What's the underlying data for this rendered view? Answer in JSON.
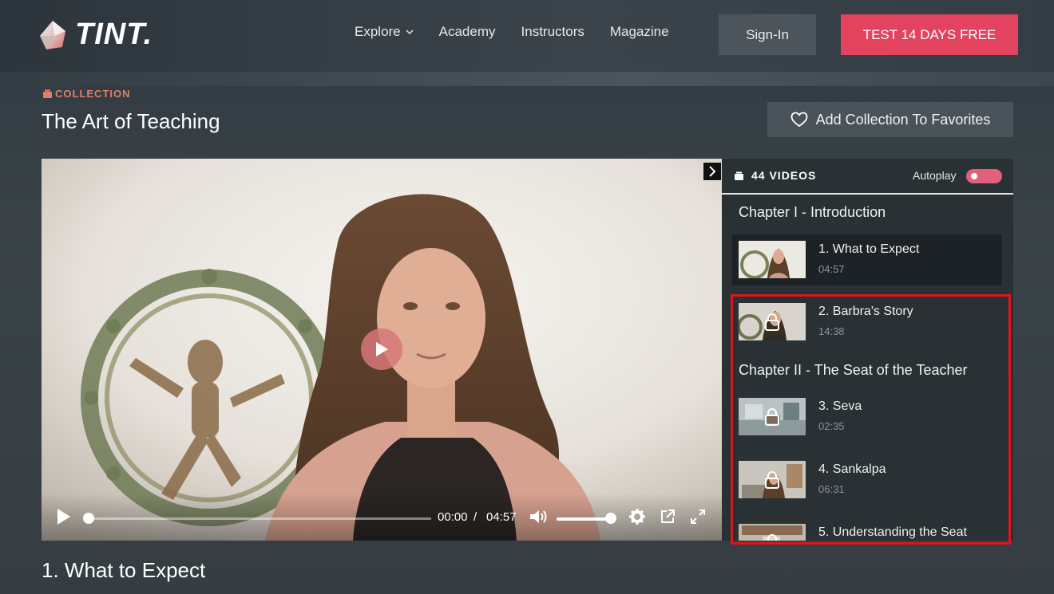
{
  "brand": {
    "name": "TINT."
  },
  "nav": {
    "explore": "Explore",
    "academy": "Academy",
    "instructors": "Instructors",
    "magazine": "Magazine",
    "sign_in": "Sign-In",
    "trial": "TEST 14 DAYS FREE"
  },
  "collection": {
    "tag": "COLLECTION",
    "title": "The Art of Teaching",
    "favorites_button": "Add Collection To Favorites"
  },
  "player": {
    "current_time": "00:00",
    "separator": "/",
    "duration": "04:57",
    "progress": 0.0,
    "volume": 1.0
  },
  "playlist": {
    "count_label": "44 VIDEOS",
    "autoplay_label": "Autoplay",
    "autoplay_on": true,
    "chapters": [
      {
        "title": "Chapter I - Introduction"
      },
      {
        "title": "Chapter II - The Seat of the Teacher"
      }
    ],
    "items": [
      {
        "title": "1. What to Expect",
        "duration": "04:57",
        "locked": false,
        "active": true
      },
      {
        "title": "2. Barbra's Story",
        "duration": "14:38",
        "locked": true,
        "active": false
      },
      {
        "title": "3. Seva",
        "duration": "02:35",
        "locked": true,
        "active": false
      },
      {
        "title": "4. Sankalpa",
        "duration": "06:31",
        "locked": true,
        "active": false
      },
      {
        "title": "5. Understanding the Seat",
        "duration": "",
        "locked": true,
        "active": false
      }
    ]
  },
  "now_playing_title": "1. What to Expect",
  "colors": {
    "accent": "#e3435f",
    "tag": "#e27f6d",
    "highlight": "#e0141c"
  }
}
